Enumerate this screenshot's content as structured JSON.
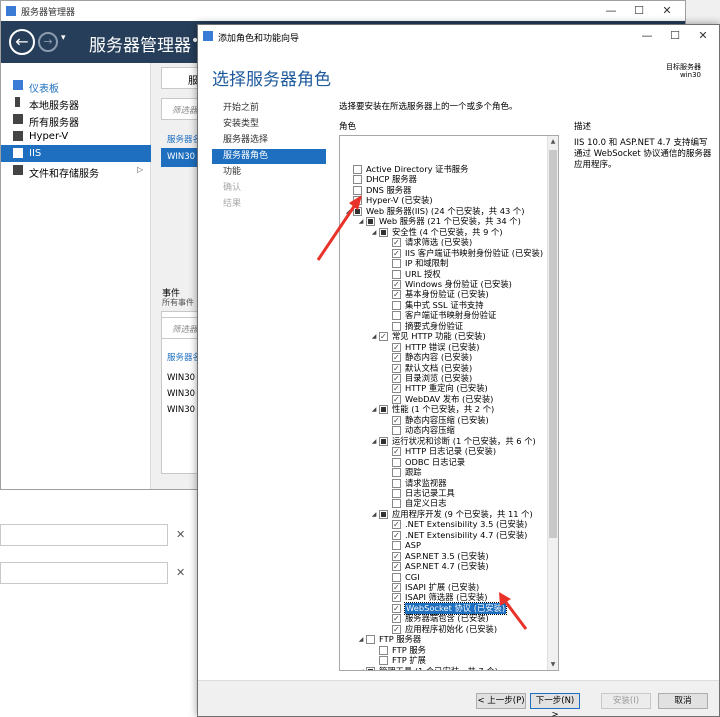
{
  "server_manager": {
    "title": "服务器管理器",
    "header_title": "服务器管理器",
    "header_arrow": "•",
    "nav_back": "←",
    "nav_forward": "→",
    "nav_dropdown": "▾",
    "window_controls": {
      "minimize": "—",
      "maximize": "☐",
      "close": "✕"
    },
    "nav": [
      {
        "label": "仪表板",
        "active": false
      },
      {
        "label": "本地服务器",
        "active": false
      },
      {
        "label": "所有服务器",
        "active": false
      },
      {
        "label": "Hyper-V",
        "active": false
      },
      {
        "label": "IIS",
        "active": true
      },
      {
        "label": "文件和存储服务",
        "active": false,
        "chevron": "▷"
      }
    ],
    "panel_fragments": {
      "top_tag": "服",
      "filter1": "筛选器",
      "servers1": "服务器名",
      "row1": "WIN30",
      "events": "事件",
      "all_events": "所有事件",
      "filter2": "筛选器",
      "servers2": "服务器名",
      "rows2": [
        "WIN30",
        "WIN30",
        "WIN30"
      ]
    },
    "lower_x": "✕"
  },
  "dialog": {
    "title": "添加角色和功能向导",
    "window_controls": {
      "minimize": "—",
      "maximize": "☐",
      "close": "✕"
    },
    "heading": "选择服务器角色",
    "target_label": "目标服务器",
    "target_name": "win30",
    "steps": [
      {
        "label": "开始之前",
        "state": "normal"
      },
      {
        "label": "安装类型",
        "state": "normal"
      },
      {
        "label": "服务器选择",
        "state": "normal"
      },
      {
        "label": "服务器角色",
        "state": "active"
      },
      {
        "label": "功能",
        "state": "normal"
      },
      {
        "label": "确认",
        "state": "disabled"
      },
      {
        "label": "结果",
        "state": "disabled"
      }
    ],
    "instruction": "选择要安装在所选服务器上的一个或多个角色。",
    "roles_header": "角色",
    "description_header": "描述",
    "description_text": "IIS 10.0 和 ASP.NET 4.7 支持编写通过 WebSocket 协议通信的服务器应用程序。",
    "tree": [
      {
        "label": "Active Directory 证书服务",
        "level": 0,
        "state": "unchecked",
        "expander": ""
      },
      {
        "label": "DHCP 服务器",
        "level": 0,
        "state": "unchecked",
        "expander": ""
      },
      {
        "label": "DNS 服务器",
        "level": 0,
        "state": "unchecked",
        "expander": ""
      },
      {
        "label": "Hyper-V (已安装)",
        "level": 0,
        "state": "checked",
        "expander": ""
      },
      {
        "label": "Web 服务器(IIS) (24 个已安装，共 43 个)",
        "level": 0,
        "state": "partial",
        "expander": "◢"
      },
      {
        "label": "Web 服务器 (21 个已安装，共 34 个)",
        "level": 1,
        "state": "partial",
        "expander": "◢"
      },
      {
        "label": "安全性 (4 个已安装，共 9 个)",
        "level": 2,
        "state": "partial",
        "expander": "◢"
      },
      {
        "label": "请求筛选 (已安装)",
        "level": 3,
        "state": "checked",
        "expander": ""
      },
      {
        "label": "IIS 客户端证书映射身份验证 (已安装)",
        "level": 3,
        "state": "checked",
        "expander": ""
      },
      {
        "label": "IP 和域限制",
        "level": 3,
        "state": "unchecked",
        "expander": ""
      },
      {
        "label": "URL 授权",
        "level": 3,
        "state": "unchecked",
        "expander": ""
      },
      {
        "label": "Windows 身份验证 (已安装)",
        "level": 3,
        "state": "checked",
        "expander": ""
      },
      {
        "label": "基本身份验证 (已安装)",
        "level": 3,
        "state": "checked",
        "expander": ""
      },
      {
        "label": "集中式 SSL 证书支持",
        "level": 3,
        "state": "unchecked",
        "expander": ""
      },
      {
        "label": "客户端证书映射身份验证",
        "level": 3,
        "state": "unchecked",
        "expander": ""
      },
      {
        "label": "摘要式身份验证",
        "level": 3,
        "state": "unchecked",
        "expander": ""
      },
      {
        "label": "常见 HTTP 功能 (已安装)",
        "level": 2,
        "state": "checked",
        "expander": "◢"
      },
      {
        "label": "HTTP 错误 (已安装)",
        "level": 3,
        "state": "checked",
        "expander": ""
      },
      {
        "label": "静态内容 (已安装)",
        "level": 3,
        "state": "checked",
        "expander": ""
      },
      {
        "label": "默认文档 (已安装)",
        "level": 3,
        "state": "checked",
        "expander": ""
      },
      {
        "label": "目录浏览 (已安装)",
        "level": 3,
        "state": "checked",
        "expander": ""
      },
      {
        "label": "HTTP 重定向 (已安装)",
        "level": 3,
        "state": "checked",
        "expander": ""
      },
      {
        "label": "WebDAV 发布 (已安装)",
        "level": 3,
        "state": "checked",
        "expander": ""
      },
      {
        "label": "性能 (1 个已安装，共 2 个)",
        "level": 2,
        "state": "partial",
        "expander": "◢"
      },
      {
        "label": "静态内容压缩 (已安装)",
        "level": 3,
        "state": "checked",
        "expander": ""
      },
      {
        "label": "动态内容压缩",
        "level": 3,
        "state": "unchecked",
        "expander": ""
      },
      {
        "label": "运行状况和诊断 (1 个已安装，共 6 个)",
        "level": 2,
        "state": "partial",
        "expander": "◢"
      },
      {
        "label": "HTTP 日志记录 (已安装)",
        "level": 3,
        "state": "checked",
        "expander": ""
      },
      {
        "label": "ODBC 日志记录",
        "level": 3,
        "state": "unchecked",
        "expander": ""
      },
      {
        "label": "跟踪",
        "level": 3,
        "state": "unchecked",
        "expander": ""
      },
      {
        "label": "请求监视器",
        "level": 3,
        "state": "unchecked",
        "expander": ""
      },
      {
        "label": "日志记录工具",
        "level": 3,
        "state": "unchecked",
        "expander": ""
      },
      {
        "label": "自定义日志",
        "level": 3,
        "state": "unchecked",
        "expander": ""
      },
      {
        "label": "应用程序开发 (9 个已安装，共 11 个)",
        "level": 2,
        "state": "partial",
        "expander": "◢"
      },
      {
        "label": ".NET Extensibility 3.5 (已安装)",
        "level": 3,
        "state": "checked",
        "expander": ""
      },
      {
        "label": ".NET Extensibility 4.7 (已安装)",
        "level": 3,
        "state": "checked",
        "expander": ""
      },
      {
        "label": "ASP",
        "level": 3,
        "state": "unchecked",
        "expander": ""
      },
      {
        "label": "ASP.NET 3.5 (已安装)",
        "level": 3,
        "state": "checked",
        "expander": ""
      },
      {
        "label": "ASP.NET 4.7 (已安装)",
        "level": 3,
        "state": "checked",
        "expander": ""
      },
      {
        "label": "CGI",
        "level": 3,
        "state": "unchecked",
        "expander": ""
      },
      {
        "label": "ISAPI 扩展 (已安装)",
        "level": 3,
        "state": "checked",
        "expander": ""
      },
      {
        "label": "ISAPI 筛选器 (已安装)",
        "level": 3,
        "state": "checked",
        "expander": ""
      },
      {
        "label": "WebSocket 协议 (已安装)",
        "level": 3,
        "state": "checked",
        "expander": "",
        "highlight": true
      },
      {
        "label": "服务器端包含 (已安装)",
        "level": 3,
        "state": "checked",
        "expander": ""
      },
      {
        "label": "应用程序初始化 (已安装)",
        "level": 3,
        "state": "checked",
        "expander": ""
      },
      {
        "label": "FTP 服务器",
        "level": 1,
        "state": "unchecked",
        "expander": "◢"
      },
      {
        "label": "FTP 服务",
        "level": 2,
        "state": "unchecked",
        "expander": ""
      },
      {
        "label": "FTP 扩展",
        "level": 2,
        "state": "unchecked",
        "expander": ""
      },
      {
        "label": "管理工具 (1 个已安装，共 7 个)",
        "level": 1,
        "state": "partial",
        "expander": "◢"
      },
      {
        "label": "IIS 管理控制台 (已安装)",
        "level": 2,
        "state": "checked",
        "expander": ""
      }
    ],
    "scroll_up": "▲",
    "scroll_down": "▼",
    "buttons": {
      "previous": "< 上一步(P)",
      "next": "下一步(N) >",
      "install": "安装(I)",
      "cancel": "取消"
    }
  },
  "colors": {
    "accent": "#1e6fbf",
    "header_bg": "#263e5a",
    "heading": "#1e5a9c",
    "annotation": "#e8322a"
  }
}
